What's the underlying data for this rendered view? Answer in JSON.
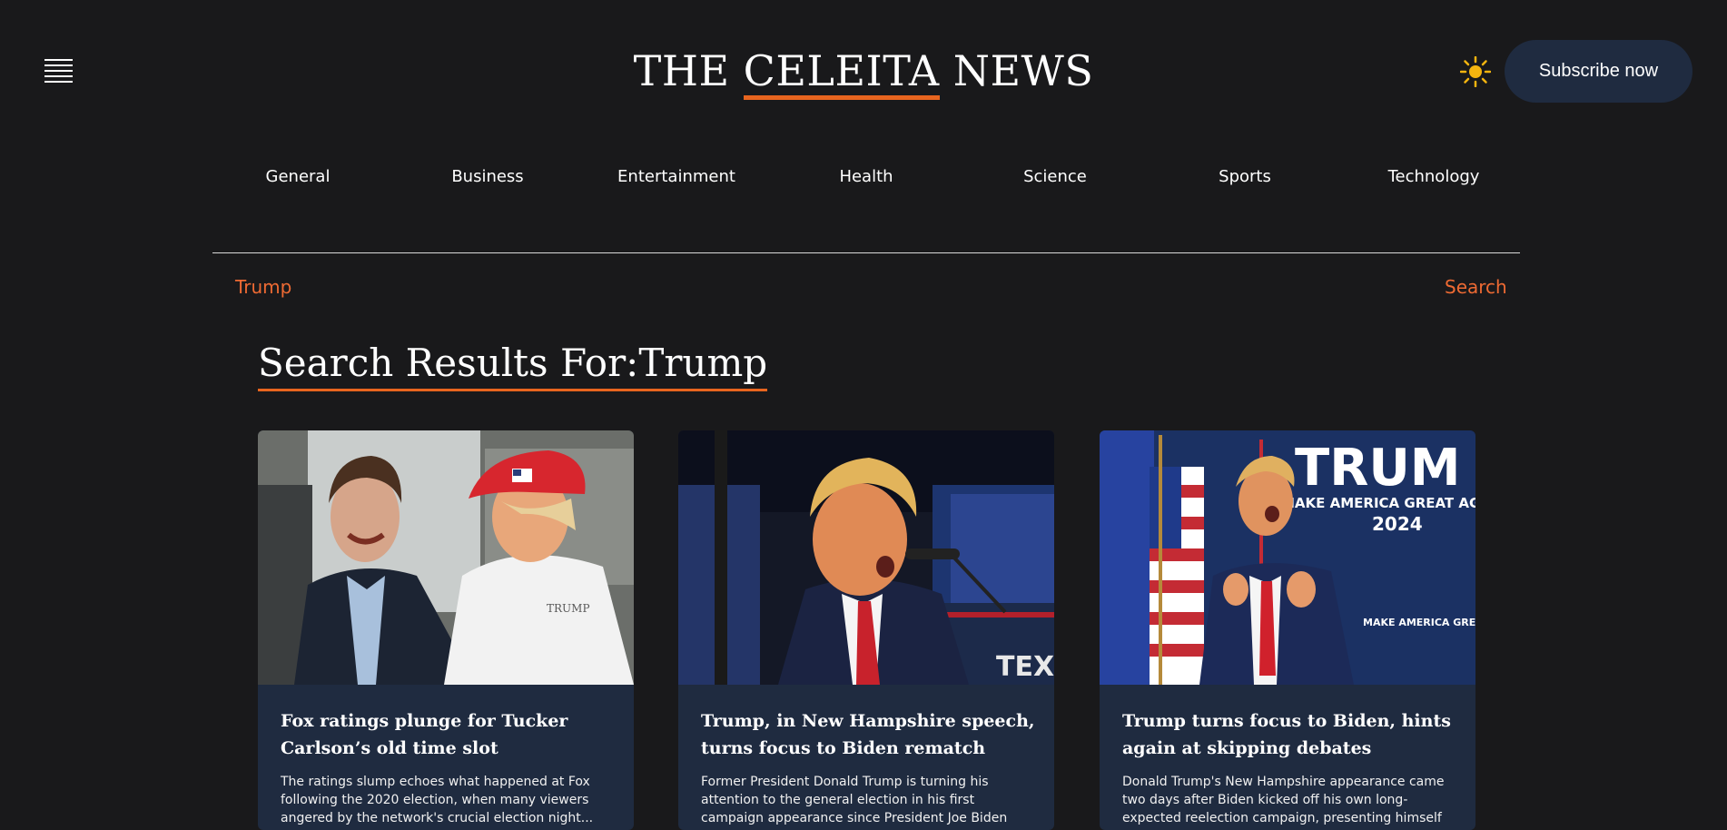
{
  "header": {
    "logo_left": "THE ",
    "logo_mid": "CELEITA",
    "logo_right": " NEWS",
    "subscribe_label": "Subscribe now",
    "accent_color": "#e8651f",
    "icons": [
      "hamburger-icon",
      "sun-icon"
    ]
  },
  "nav": {
    "items": [
      "General",
      "Business",
      "Entertainment",
      "Health",
      "Science",
      "Sports",
      "Technology"
    ]
  },
  "search": {
    "query": "Trump",
    "button_label": "Search"
  },
  "results": {
    "heading_label": "Search Results For:",
    "heading_query": "Trump"
  },
  "cards": [
    {
      "title": "Fox ratings plunge for Tucker Carlson’s old time slot",
      "description": "The ratings slump echoes what happened at Fox following the 2020 election, when many viewers angered by the network's crucial election night..."
    },
    {
      "title": "Trump, in New Hampshire speech, turns focus to Biden rematch",
      "description": "Former President Donald Trump is turning his attention to the general election in his first campaign appearance since President Joe Biden launched his..."
    },
    {
      "title": "Trump turns focus to Biden, hints again at skipping debates",
      "description": "Donald Trump's New Hampshire appearance came two days after Biden kicked off his own long-expected reelection campaign, presenting himself as he did in...",
      "image_text": [
        "TRUM",
        "MAKE AMERICA GREAT AG",
        "2024",
        "MAKE AMERICA GREAT AGAIN!"
      ]
    }
  ]
}
